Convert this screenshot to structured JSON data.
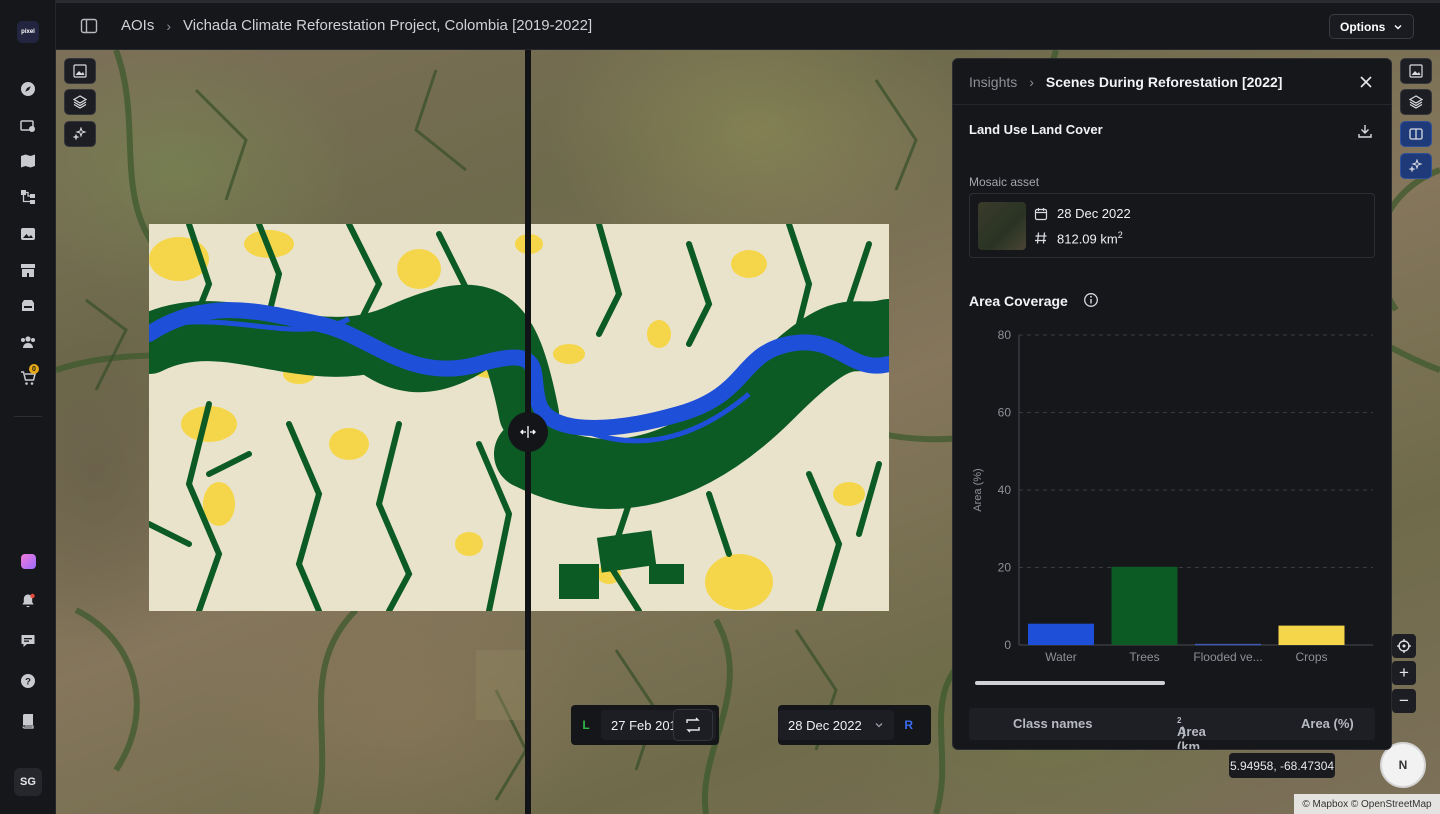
{
  "sidebar": {
    "logo_text": "pixel",
    "cart_count": "0",
    "avatar_initials": "SG",
    "items": [
      {
        "name": "explore",
        "icon": "compass-icon"
      },
      {
        "name": "tasking",
        "icon": "satellite-icon"
      },
      {
        "name": "maps",
        "icon": "map-icon"
      },
      {
        "name": "workflows",
        "icon": "workflow-icon"
      },
      {
        "name": "imagery",
        "icon": "image-icon"
      },
      {
        "name": "marketplace",
        "icon": "store-icon"
      },
      {
        "name": "storage",
        "icon": "database-icon"
      },
      {
        "name": "team",
        "icon": "users-icon"
      },
      {
        "name": "cart",
        "icon": "cart-icon"
      }
    ]
  },
  "header": {
    "breadcrumb_root": "AOIs",
    "breadcrumb_current": "Vichada Climate Reforestation Project, Colombia [2019-2022]",
    "options_label": "Options"
  },
  "date_bar": {
    "left_tag": "L",
    "left_date": "27 Feb 2019",
    "right_date": "28 Dec 2022",
    "right_tag": "R",
    "left_color": "#2fb84a",
    "right_color": "#3b6cf0"
  },
  "map": {
    "coordinates": "5.94958, -68.47304",
    "attribution": "© Mapbox © OpenStreetMap",
    "compass_label": "N"
  },
  "panel": {
    "crumb_parent": "Insights",
    "crumb_current": "Scenes During Reforestation [2022]",
    "lulc_title": "Land Use Land Cover",
    "mosaic_label": "Mosaic asset",
    "mosaic_date": "28 Dec 2022",
    "mosaic_area_value": "812.09 km",
    "mosaic_area_sup": "2",
    "area_coverage_title": "Area Coverage",
    "table_headers": {
      "class_names": "Class names",
      "area_km": "Area (km",
      "area_km_sup": "2",
      "area_km_close": ")",
      "area_pct": "Area (%)"
    }
  },
  "chart_data": {
    "type": "bar",
    "categories": [
      "Water",
      "Trees",
      "Flooded ve...",
      "Crops"
    ],
    "values": [
      5.5,
      20.2,
      0.3,
      5.0
    ],
    "colors": [
      "#1e4fd8",
      "#0c5a24",
      "#3d5ab0",
      "#f5d64a"
    ],
    "ylabel": "Area (%)",
    "ylim": [
      0,
      80
    ],
    "yticks": [
      0,
      20,
      40,
      60,
      80
    ],
    "grid": true
  },
  "colors": {
    "water": "#1e4fd8",
    "trees": "#0c5a24",
    "crops": "#f5d64a",
    "bare": "#e9e3cc",
    "accent": "#1f3a78"
  }
}
